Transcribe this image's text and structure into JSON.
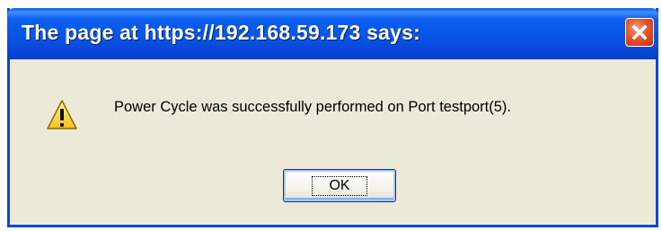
{
  "dialog": {
    "title": "The page at https://192.168.59.173 says:",
    "message": "Power Cycle was successfully performed on Port testport(5).",
    "ok_label": "OK",
    "icon": "warning-icon"
  },
  "colors": {
    "titlebar": "#0a55e6",
    "frame": "#0846d8",
    "body": "#ece9d8",
    "close_button": "#e0552a"
  }
}
